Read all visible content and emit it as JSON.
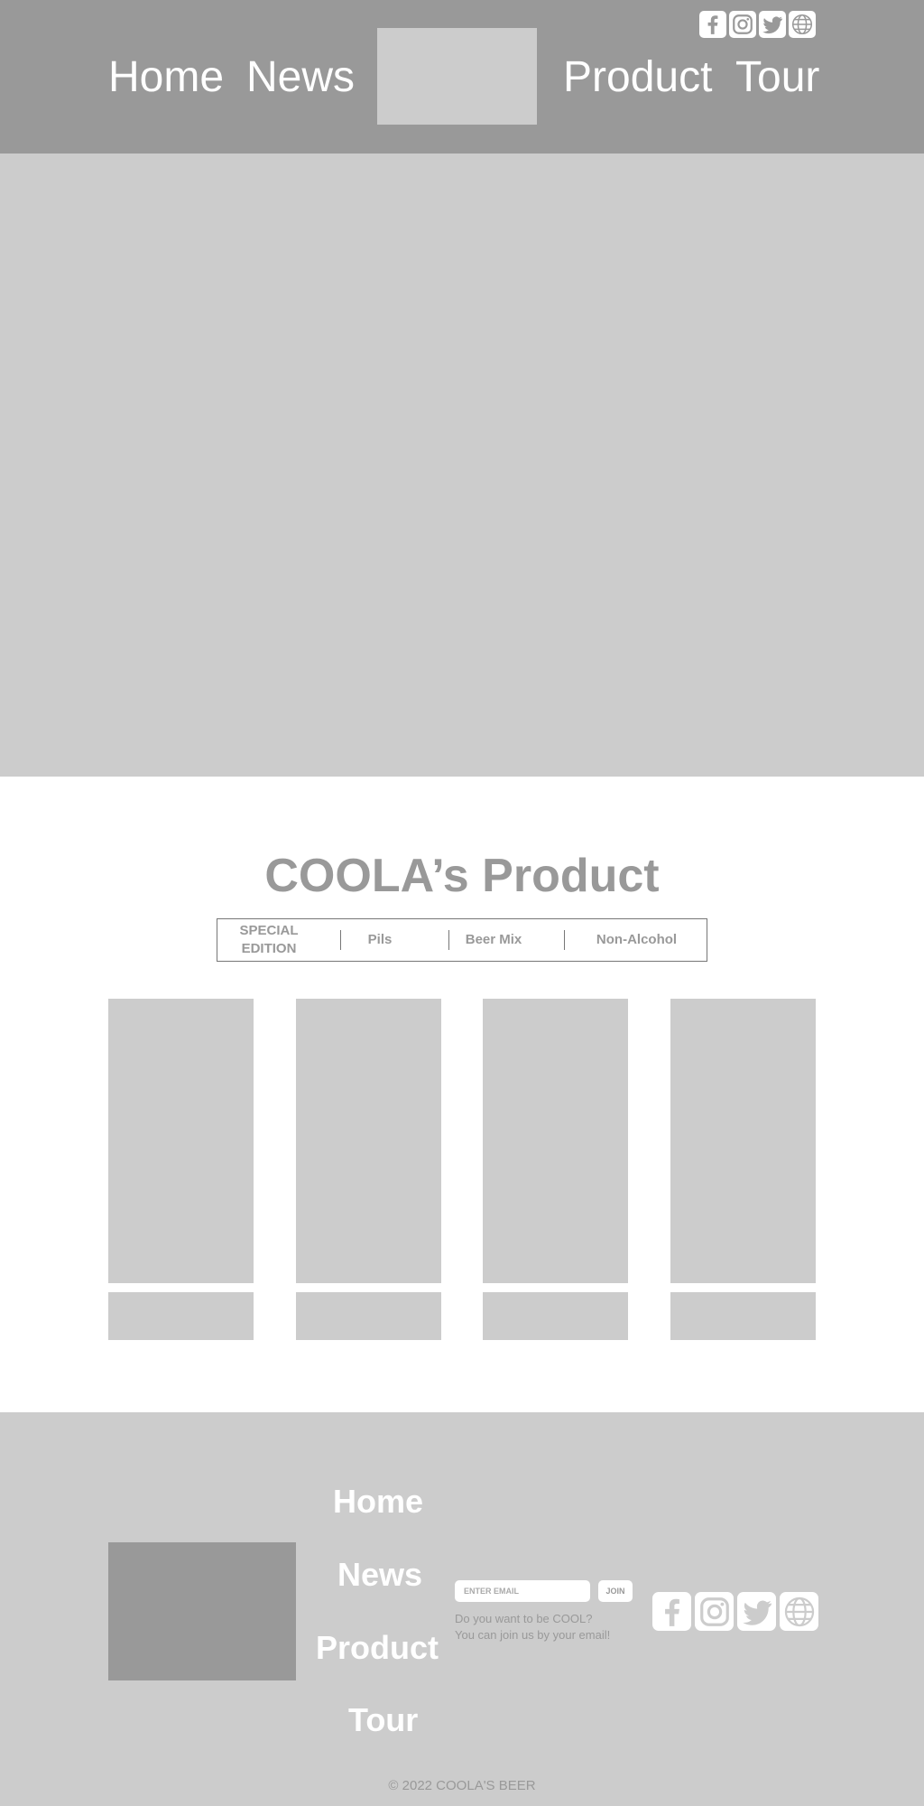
{
  "colors": {
    "header_bg": "#999999",
    "placeholder": "#cccccc",
    "text_gray": "#999999",
    "white": "#ffffff"
  },
  "header": {
    "social_icons": [
      "facebook-icon",
      "instagram-icon",
      "twitter-icon",
      "globe-icon"
    ],
    "nav": {
      "home": "Home",
      "news": "News",
      "product": "Product",
      "tour": "Tour"
    }
  },
  "products": {
    "title": "COOLA’s Product",
    "tabs": {
      "special": "SPECIAL EDITION",
      "pils": "Pils",
      "beer_mix": "Beer Mix",
      "non_alcohol": "Non-Alcohol"
    }
  },
  "footer": {
    "nav": {
      "home": "Home",
      "news": "News",
      "product": "Product",
      "tour": "Tour"
    },
    "email_placeholder": "ENTER EMAIL",
    "join_label": "JOIN",
    "join_line1": "Do you want to be COOL?",
    "join_line2": "You can join us by your email!",
    "social_icons": [
      "facebook-icon",
      "instagram-icon",
      "twitter-icon",
      "globe-icon"
    ],
    "copyright": "© 2022 COOLA'S BEER"
  }
}
